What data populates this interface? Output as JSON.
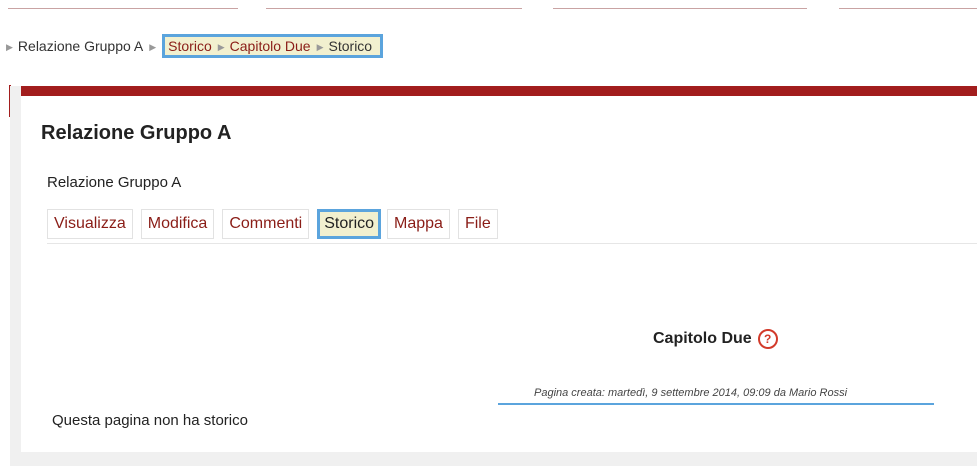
{
  "breadcrumb": {
    "items": [
      "Relazione Gruppo A",
      "Storico",
      "Capitolo Due",
      "Storico"
    ]
  },
  "page": {
    "title": "Relazione Gruppo A",
    "subtitle": "Relazione Gruppo A"
  },
  "tabs": [
    "Visualizza",
    "Modifica",
    "Commenti",
    "Storico",
    "Mappa",
    "File"
  ],
  "active_tab": "Storico",
  "section": {
    "title": "Capitolo Due",
    "help_icon": "?",
    "created": "Pagina creata: martedì, 9 settembre 2014, 09:09 da Mario Rossi"
  },
  "message": "Questa pagina non ha storico",
  "colors": {
    "accent": "#a21d1d",
    "link": "#8a1d17",
    "highlight_fill": "#f2f0cf",
    "highlight_border": "#5ba4dd"
  }
}
